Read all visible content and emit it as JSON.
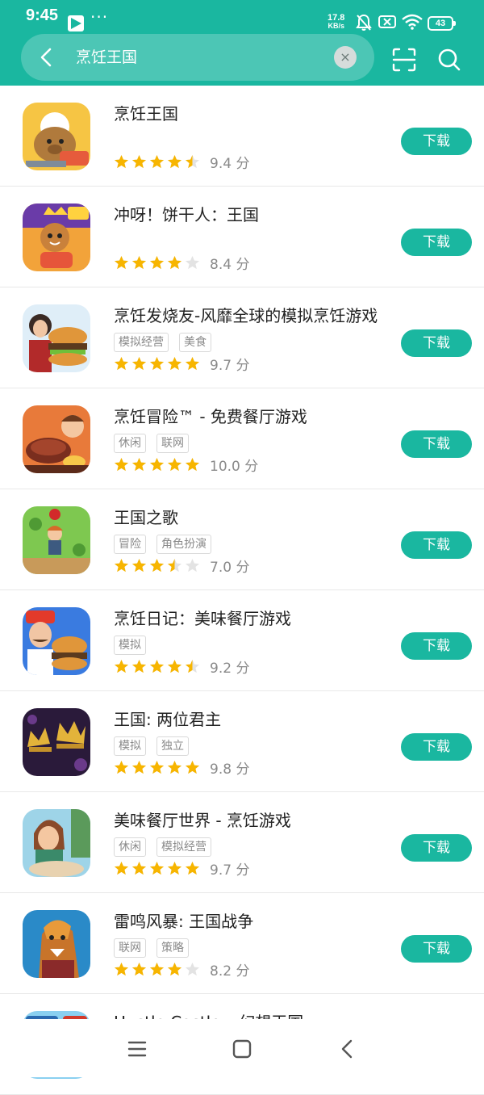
{
  "status_bar": {
    "time": "9:45",
    "dots": "···",
    "net_speed_value": "17.8",
    "net_speed_unit": "KB/s",
    "battery": "43"
  },
  "search": {
    "query": "烹饪王国",
    "clear_label": "×"
  },
  "colors": {
    "accent": "#1ab7a0",
    "star": "#f7b500",
    "star_empty": "#e3e3e3"
  },
  "apps": [
    {
      "title": "烹饪王国",
      "tags": [],
      "rating": 4.5,
      "score": "9.4 分",
      "button": "下载"
    },
    {
      "title": "冲呀！饼干人：王国",
      "tags": [],
      "rating": 4,
      "score": "8.4 分",
      "button": "下载"
    },
    {
      "title": "烹饪发烧友-风靡全球的模拟烹饪游戏",
      "tags": [
        "模拟经营",
        "美食"
      ],
      "rating": 5,
      "score": "9.7 分",
      "button": "下载"
    },
    {
      "title": "烹饪冒险™ - 免费餐厅游戏",
      "tags": [
        "休闲",
        "联网"
      ],
      "rating": 5,
      "score": "10.0 分",
      "button": "下载"
    },
    {
      "title": "王国之歌",
      "tags": [
        "冒险",
        "角色扮演"
      ],
      "rating": 3.5,
      "score": "7.0 分",
      "button": "下载"
    },
    {
      "title": "烹饪日记：美味餐厅游戏",
      "tags": [
        "模拟"
      ],
      "rating": 4.5,
      "score": "9.2 分",
      "button": "下载"
    },
    {
      "title": "王国: 两位君主",
      "tags": [
        "模拟",
        "独立"
      ],
      "rating": 5,
      "score": "9.8 分",
      "button": "下载"
    },
    {
      "title": "美味餐厅世界 - 烹饪游戏",
      "tags": [
        "休闲",
        "模拟经营"
      ],
      "rating": 5,
      "score": "9.7 分",
      "button": "下载"
    },
    {
      "title": "雷鸣风暴: 王国战争",
      "tags": [
        "联网",
        "策略"
      ],
      "rating": 4,
      "score": "8.2 分",
      "button": "下载"
    },
    {
      "title": "Hustle Castle – 幻想王国",
      "tags": [],
      "rating": 0,
      "score": "",
      "button": ""
    }
  ],
  "icons": {
    "status": [
      "play-store-icon",
      "mute-icon",
      "sim-off-icon",
      "wifi-icon",
      "battery-icon"
    ],
    "header": [
      "back-icon",
      "scan-icon",
      "search-icon"
    ],
    "nav": [
      "menu-icon",
      "home-icon",
      "back-nav-icon"
    ]
  }
}
